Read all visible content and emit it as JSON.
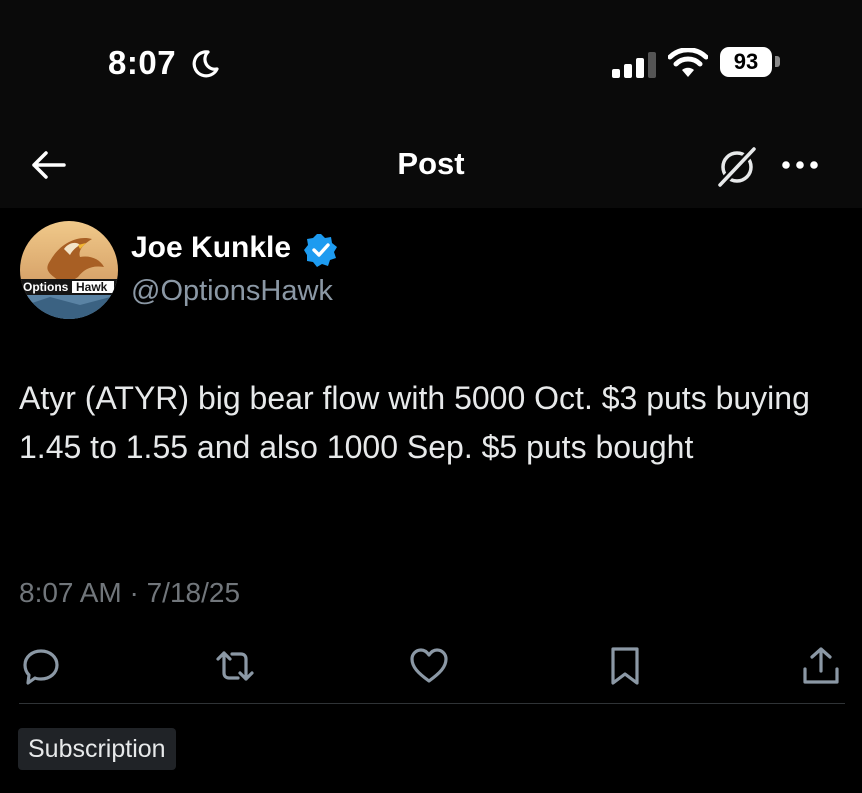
{
  "status_bar": {
    "time": "8:07",
    "battery": "93"
  },
  "nav": {
    "title": "Post"
  },
  "post": {
    "author_name": "Joe Kunkle",
    "author_handle": "@OptionsHawk",
    "avatar_logo_text": "OptionsHawk",
    "text": "Atyr (ATYR) big bear flow with 5000 Oct. $3 puts buying 1.45 to 1.55 and also 1000 Sep. $5 puts bought",
    "timestamp": "8:07 AM · 7/18/25"
  },
  "actions": [
    "reply-icon",
    "repost-icon",
    "like-icon",
    "bookmark-icon",
    "share-icon"
  ],
  "subscription_label": "Subscription",
  "colors": {
    "background": "#000000",
    "accent_verified": "#1d9bf0",
    "secondary_text": "#71767b",
    "handle_text": "#8b98a5"
  }
}
